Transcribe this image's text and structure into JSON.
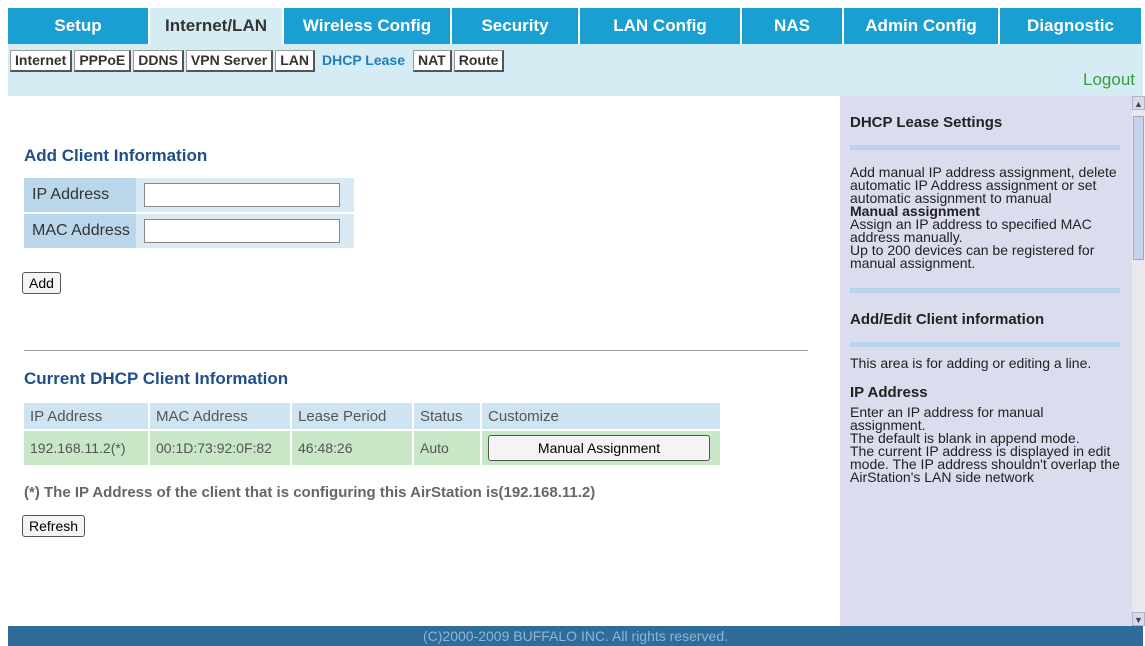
{
  "nav": {
    "tabs": [
      {
        "label": "Setup"
      },
      {
        "label": "Internet/LAN"
      },
      {
        "label": "Wireless Config"
      },
      {
        "label": "Security"
      },
      {
        "label": "LAN Config"
      },
      {
        "label": "NAS"
      },
      {
        "label": "Admin Config"
      },
      {
        "label": "Diagnostic"
      }
    ],
    "active_tab": "Internet/LAN",
    "subtabs": [
      {
        "label": "Internet"
      },
      {
        "label": "PPPoE"
      },
      {
        "label": "DDNS"
      },
      {
        "label": "VPN Server"
      },
      {
        "label": "LAN"
      },
      {
        "label": "DHCP Lease"
      },
      {
        "label": "NAT"
      },
      {
        "label": "Route"
      }
    ],
    "active_subtab": "DHCP Lease",
    "logout": "Logout"
  },
  "add_client": {
    "title": "Add Client Information",
    "ip_label": "IP Address",
    "ip_value": "",
    "mac_label": "MAC Address",
    "mac_value": "",
    "add_button": "Add"
  },
  "current": {
    "title": "Current DHCP Client Information",
    "columns": [
      "IP Address",
      "MAC Address",
      "Lease Period",
      "Status",
      "Customize"
    ],
    "rows": [
      {
        "ip": "192.168.11.2(*)",
        "mac": "00:1D:73:92:0F:82",
        "lease": "46:48:26",
        "status": "Auto",
        "action": "Manual Assignment"
      }
    ],
    "note": "(*) The IP Address of the client that is configuring this AirStation is(192.168.11.2)",
    "refresh_button": "Refresh"
  },
  "help": {
    "heading1": "DHCP Lease Settings",
    "text1": "Add manual IP address assignment, delete automatic IP Address assignment or set automatic assignment to manual",
    "bold1": "Manual assignment",
    "text2": "Assign an IP address to specified MAC address manually.",
    "text3": "Up to 200 devices can be registered for manual assignment.",
    "heading2": "Add/Edit Client information",
    "text4": "This area is for adding or editing a line.",
    "heading3": "IP Address",
    "text5": "Enter an IP address for manual assignment.",
    "text6": "The default is blank in append mode.",
    "text7": "The current IP address is displayed in edit mode. The IP address shouldn't overlap the AirStation's LAN side network"
  },
  "footer": "(C)2000-2009 BUFFALO INC. All rights reserved.",
  "colors": {
    "tab_blue": "#1a9fd3",
    "band": "#d6ecf5",
    "title_blue": "#1f4e8c",
    "help_bg": "#dcdcef",
    "footer": "#2f6c9a"
  },
  "icons": {
    "scroll_up": "scroll-up-arrow-icon",
    "scroll_down": "scroll-down-arrow-icon"
  }
}
